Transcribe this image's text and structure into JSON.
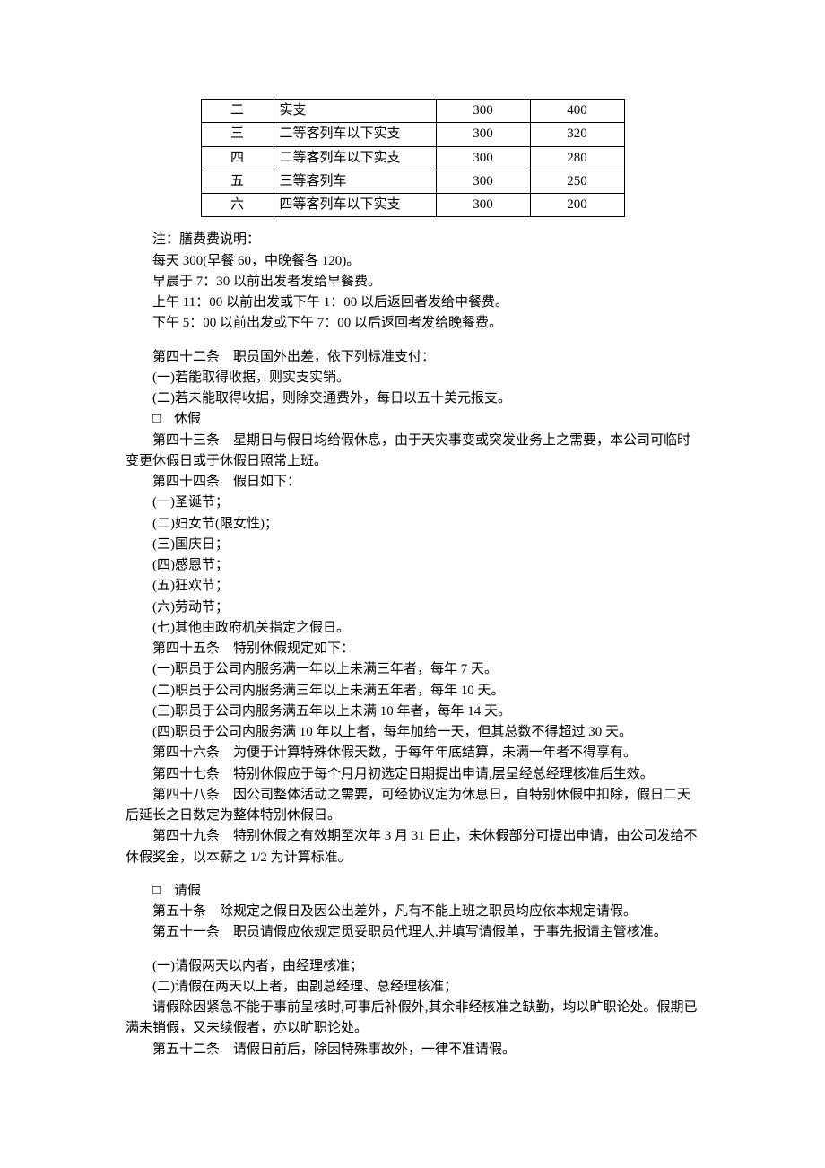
{
  "table": {
    "rows": [
      {
        "level": "二",
        "desc": "实支",
        "meal": "300",
        "lodging": "400"
      },
      {
        "level": "三",
        "desc": "二等客列车以下实支",
        "meal": "300",
        "lodging": "320"
      },
      {
        "level": "四",
        "desc": "二等客列车以下实支",
        "meal": "300",
        "lodging": "280"
      },
      {
        "level": "五",
        "desc": "三等客列车",
        "meal": "300",
        "lodging": "250"
      },
      {
        "level": "六",
        "desc": "四等客列车以下实支",
        "meal": "300",
        "lodging": "200"
      }
    ]
  },
  "note": {
    "heading": "注：膳费费说明：",
    "l1": "每天 300(早餐 60，中晚餐各 120)。",
    "l2": "早晨于 7：30 以前出发者发给早餐费。",
    "l3": "上午 11：00 以前出发或下午 1：00 以后返回者发给中餐费。",
    "l4": "下午 5：00 以前出发或下午 7：00 以后返回者发给晚餐费。"
  },
  "a42": {
    "title": "第四十二条　职员国外出差，依下列标准支付：",
    "i1": "(一)若能取得收据，则实支实销。",
    "i2": "(二)若未能取得收据，则除交通费外，每日以五十美元报支。"
  },
  "sec_leave": "□　休假",
  "a43": "　　第四十三条　星期日与假日均给假休息，由于天灾事变或突发业务上之需要，本公司可临时变更休假日或于休假日照常上班。",
  "a44": {
    "title": "第四十四条　假日如下：",
    "i1": "(一)圣诞节；",
    "i2": "(二)妇女节(限女性)；",
    "i3": "(三)国庆日；",
    "i4": "(四)感恩节；",
    "i5": "(五)狂欢节；",
    "i6": "(六)劳动节；",
    "i7": "(七)其他由政府机关指定之假日。"
  },
  "a45": {
    "title": "第四十五条　特别休假规定如下：",
    "i1": "(一)职员于公司内服务满一年以上未满三年者，每年 7 天。",
    "i2": "(二)职员于公司内服务满三年以上未满五年者，每年 10 天。",
    "i3": "(三)职员于公司内服务满五年以上未满 10 年者，每年 14 天。",
    "i4": "(四)职员于公司内服务满 10 年以上者，每年加给一天，但其总数不得超过 30 天。"
  },
  "a46": "第四十六条　为便于计算特殊休假天数，于每年年底结算，未满一年者不得享有。",
  "a47": "第四十七条　特别休假应于每个月月初选定日期提出申请,层呈经总经理核准后生效。",
  "a48": "　　第四十八条　因公司整体活动之需要，可经协议定为休息日，自特别休假中扣除，假日二天后延长之日数定为整体特别休假日。",
  "a49": "　　第四十九条　特别休假之有效期至次年 3 月 31 日止，未休假部分可提出申请，由公司发给不休假奖金，以本薪之 1/2 为计算标准。",
  "sec_ask": "□　请假",
  "a50": "第五十条　除规定之假日及因公出差外，凡有不能上班之职员均应依本规定请假。",
  "a51": "第五十一条　职员请假应依规定觅妥职员代理人,并填写请假单，于事先报请主管核准。",
  "a51s": {
    "i1": "(一)请假两天以内者，由经理核准；",
    "i2": "(二)请假在两天以上者，由副总经理、总经理核准；"
  },
  "a51f": "　　请假除因紧急不能于事前呈核时,可事后补假外,其余非经核准之缺勤，均以旷职论处。假期已满未销假，又未续假者，亦以旷职论处。",
  "a52": "第五十二条　请假日前后，除因特殊事故外，一律不准请假。"
}
